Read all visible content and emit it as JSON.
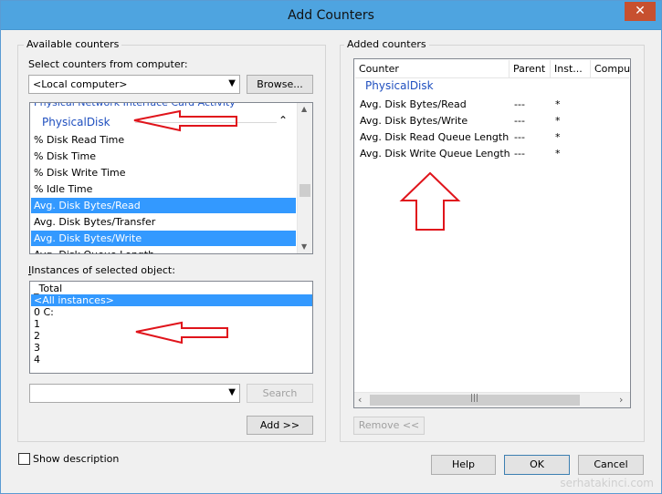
{
  "window": {
    "title": "Add Counters",
    "close_glyph": "✕"
  },
  "available": {
    "group_label": "Available counters",
    "computer_label": "Select counters from computer:",
    "computer_value": "<Local computer>",
    "browse_label": "Browse...",
    "cut_top_item": "Physical Network Interface Card Activity",
    "category": "PhysicalDisk",
    "counters": [
      {
        "label": "% Disk Read Time",
        "selected": false
      },
      {
        "label": "% Disk Time",
        "selected": false
      },
      {
        "label": "% Disk Write Time",
        "selected": false
      },
      {
        "label": "% Idle Time",
        "selected": false
      },
      {
        "label": "Avg. Disk Bytes/Read",
        "selected": true
      },
      {
        "label": "Avg. Disk Bytes/Transfer",
        "selected": false
      },
      {
        "label": "Avg. Disk Bytes/Write",
        "selected": true
      }
    ],
    "cut_bottom_item": "Avg. Disk Queue Length",
    "instances_label": "Instances of selected object:",
    "instances": [
      {
        "label": "_Total",
        "selected": false
      },
      {
        "label": "<All instances>",
        "selected": true
      },
      {
        "label": "0 C:",
        "selected": false
      },
      {
        "label": "1",
        "selected": false
      },
      {
        "label": "2",
        "selected": false
      },
      {
        "label": "3",
        "selected": false
      },
      {
        "label": "4",
        "selected": false
      }
    ],
    "search_value": "",
    "search_label": "Search",
    "add_label": "Add >>"
  },
  "added": {
    "group_label": "Added counters",
    "columns": [
      "Counter",
      "Parent",
      "Inst...",
      "Comput"
    ],
    "category": "PhysicalDisk",
    "rows": [
      {
        "counter": "Avg. Disk Bytes/Read",
        "parent": "---",
        "instance": "*"
      },
      {
        "counter": "Avg. Disk Bytes/Write",
        "parent": "---",
        "instance": "*"
      },
      {
        "counter": "Avg. Disk Read Queue Length",
        "parent": "---",
        "instance": "*"
      },
      {
        "counter": "Avg. Disk Write Queue Length",
        "parent": "---",
        "instance": "*"
      }
    ],
    "remove_label": "Remove <<"
  },
  "footer": {
    "show_description": "Show description",
    "help_label": "Help",
    "ok_label": "OK",
    "cancel_label": "Cancel"
  },
  "watermark": "serhatakinci.com",
  "colors": {
    "titlebar": "#4ea4e0",
    "selection": "#3399ff",
    "category_text": "#1f4fbf",
    "annotation_arrow": "#e0141b"
  }
}
